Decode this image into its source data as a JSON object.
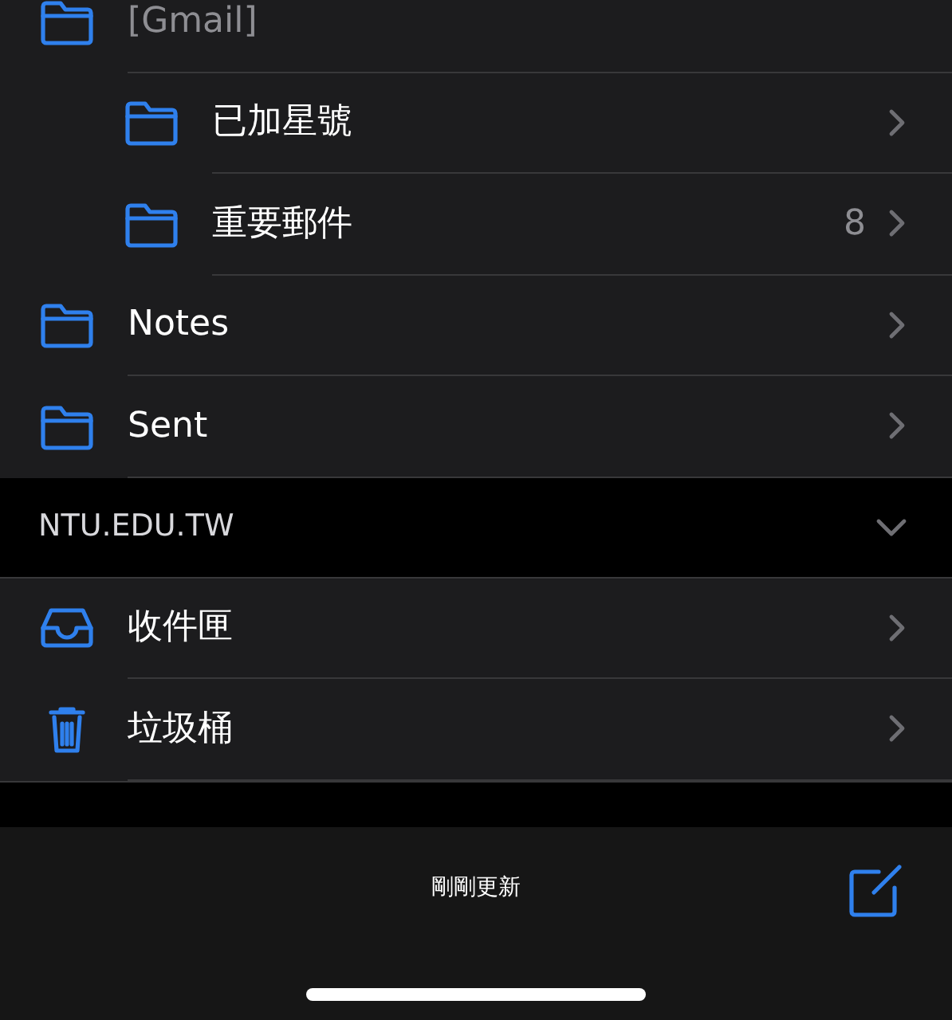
{
  "folders": [
    {
      "label": "[Gmail]",
      "dimmed": true,
      "children": [
        {
          "label": "已加星號",
          "dimmed": false
        },
        {
          "label": "重要郵件",
          "dimmed": false,
          "count": "8"
        }
      ]
    },
    {
      "label": "Notes",
      "dimmed": false
    },
    {
      "label": "Sent",
      "dimmed": false
    }
  ],
  "account": {
    "title": "NTU.EDU.TW",
    "expanded": true,
    "items": [
      {
        "kind": "inbox",
        "label": "收件匣"
      },
      {
        "kind": "trash",
        "label": "垃圾桶"
      }
    ]
  },
  "toolbar": {
    "status": "剛剛更新"
  }
}
